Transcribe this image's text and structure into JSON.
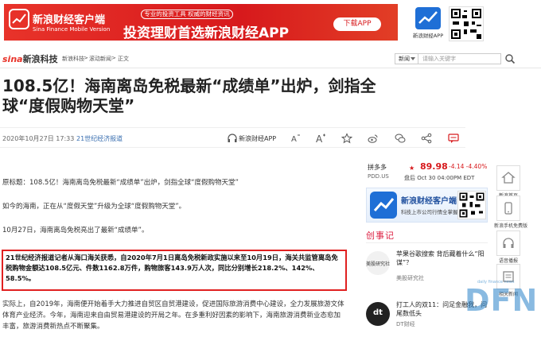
{
  "banner": {
    "brand_cn": "新浪财经客户端",
    "brand_en": "Sina Finance Mobile Version",
    "tagline_small": "专业的投资工具 权威的财经资讯",
    "tagline_big": "投资理财首选新浪财经APP",
    "download_label": "下载APP"
  },
  "promo": {
    "app_label": "新浪财经APP"
  },
  "nav": {
    "site_logo_s": "sina",
    "site_logo_text": "新浪科技",
    "breadcrumb": [
      "新浪科技",
      "滚动新闻",
      "正文"
    ],
    "select_value": "新闻",
    "search_placeholder": "请输入关键字"
  },
  "article": {
    "title": "108.5亿！海南离岛免税最新“成绩单”出炉，剑指全球“度假购物天堂”",
    "date": "2020年10月27日 17:33",
    "source": "21世纪经济报道",
    "app_label": "新浪财经APP",
    "paragraphs": [
      "原标题：108.5亿！海南离岛免税最新“成绩单”出炉，剑指全球“度假购物天堂”",
      "如今的海南，正在从“度假天堂”升级为全球“度假购物天堂”。",
      "10月27日，海南离岛免税亮出了最新“成绩单”。"
    ],
    "highlight": "21世纪经济报道记者从海口海关获悉，自2020年7月1日离岛免税新政实施以来至10月19日，海关共监管离岛免税购物金额达108.5亿元、件数1162.8万件，购物旅客143.9万人次，同比分别增长218.2%、142%、58.5%。",
    "tail": "实际上，自2019年，海南便开始着手大力推进自贸区自贸港建设，促进国际旅游消费中心建设，全力发展旅游文体体育产业经济。今年，海南迎来自由贸易港建设的开局之年。在多重利好因素的影响下，海南旅游消费新业态愈加丰富，旅游消费新热点不断聚集。"
  },
  "stock": {
    "name": "拼多多",
    "code": "PDD.US",
    "price": "89.98",
    "change": "-4.14",
    "change_pct": "-4.40%",
    "time": "盘后 Oct 30 04:00PM EDT"
  },
  "appcard": {
    "title": "新浪财经客户端",
    "subtitle": "科技上市公司行情全掌握"
  },
  "chuangshiji": {
    "heading": "创事记",
    "items": [
      {
        "thumb": "美股研究社",
        "title": "苹果谷歌搜索 背后藏着什么“阳谋”？",
        "source": "美股研究社"
      },
      {
        "thumb": "dt",
        "title": "打工人的双11：问足金融我，问尾数低头",
        "source": "DT财经"
      }
    ]
  },
  "right_toolbar": [
    {
      "label": "新浪首页",
      "icon": "home-icon"
    },
    {
      "label": "新浪手机免费版",
      "icon": "phone-icon"
    },
    {
      "label": "语音播报",
      "icon": "headphones-icon"
    },
    {
      "label": "相关新闻",
      "icon": "related-icon"
    }
  ],
  "watermark": {
    "text": "DFN",
    "small": "daily finance news"
  },
  "colors": {
    "brand_red": "#d7191c",
    "link_blue": "#3a6fb0",
    "highlight_border": "#e02020",
    "app_blue": "#1f6fd6"
  }
}
